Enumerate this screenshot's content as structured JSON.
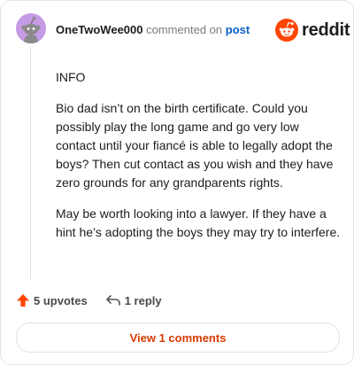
{
  "comment": {
    "username": "OneTwoWee000",
    "action_text": "commented on",
    "target_link": "post",
    "paragraphs": [
      "INFO",
      "Bio dad isn’t on the birth certificate. Could you possibly play the long game and go very low contact until your fiancé is able to legally adopt the boys? Then cut contact as you wish and they have zero grounds for any grandparents rights.",
      "May be worth looking into a lawyer. If they have a hint he’s adopting the boys they may try to interfere."
    ]
  },
  "brand": {
    "wordmark": "reddit",
    "accent": "#ff4500"
  },
  "footer": {
    "upvotes_label": "5 upvotes",
    "reply_label": "1 reply"
  },
  "view_button": {
    "label": "View 1 comments"
  },
  "icons": {
    "avatar": "snoo-avatar-icon",
    "logo": "reddit-logo-icon",
    "upvote": "upvote-arrow-icon",
    "reply": "reply-arrow-icon"
  }
}
